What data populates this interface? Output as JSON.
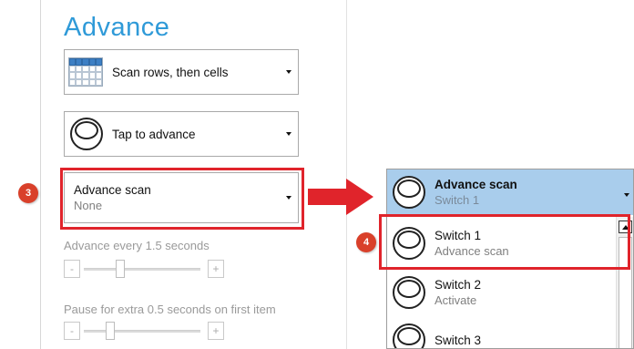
{
  "panel": {
    "title": "Advance",
    "scan_mode": {
      "label": "Scan rows, then cells",
      "icon": "scan-grid-icon"
    },
    "tap_mode": {
      "label": "Tap to advance",
      "icon": "switch-button-icon"
    },
    "advance_scan": {
      "label": "Advance scan",
      "value": "None"
    },
    "advance_every": {
      "label": "Advance every 1.5 seconds",
      "minus": "-",
      "plus": "+",
      "level": 0.3
    },
    "pause_first": {
      "label": "Pause for extra 0.5 seconds on first item",
      "minus": "-",
      "plus": "+",
      "level": 0.2
    }
  },
  "annotations": {
    "badge3": "3",
    "badge4": "4",
    "accent_color": "#e0242b"
  },
  "dropdown": {
    "header": {
      "label": "Advance scan",
      "value": "Switch 1"
    },
    "items": [
      {
        "name": "Switch 1",
        "action": "Advance scan"
      },
      {
        "name": "Switch 2",
        "action": "Activate"
      },
      {
        "name": "Switch 3",
        "action": ""
      }
    ],
    "highlight_color": "#a9cdec"
  },
  "colors": {
    "title": "#2f9ad8",
    "muted_text": "#9a9a9a"
  }
}
